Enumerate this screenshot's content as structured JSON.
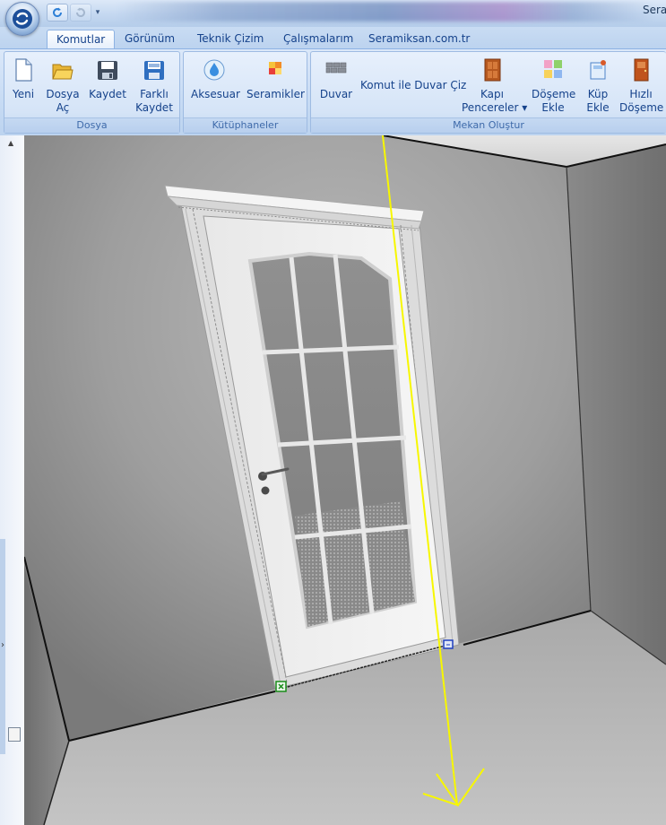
{
  "titlebar": {
    "title": "Sera",
    "qat": [
      {
        "icon": "refresh-icon"
      },
      {
        "icon": "redo-icon"
      },
      {
        "icon": "qat-dropdown-icon"
      }
    ]
  },
  "tabs": [
    {
      "label": "Komutlar",
      "active": true
    },
    {
      "label": "Görünüm"
    },
    {
      "label": "Teknik Çizim"
    },
    {
      "label": "Çalışmalarım"
    },
    {
      "label": "Seramiksan.com.tr"
    }
  ],
  "ribbon": {
    "groups": {
      "dosya": {
        "label": "Dosya",
        "buttons": {
          "yeni": {
            "l1": "Yeni",
            "l2": "",
            "icon": "new-file-icon"
          },
          "dosya_ac": {
            "l1": "Dosya",
            "l2": "Aç",
            "icon": "open-folder-icon"
          },
          "kaydet": {
            "l1": "Kaydet",
            "l2": "",
            "icon": "save-icon"
          },
          "farkli_kaydet": {
            "l1": "Farklı",
            "l2": "Kaydet",
            "icon": "save-as-icon"
          }
        }
      },
      "kutuphaneler": {
        "label": "Kütüphaneler",
        "buttons": {
          "aksesuar": {
            "l1": "Aksesuar",
            "icon": "water-drop-icon"
          },
          "seramikler": {
            "l1": "Seramikler",
            "icon": "tiles-icon"
          }
        }
      },
      "mekan": {
        "label": "Mekan Oluştur",
        "buttons": {
          "duvar": {
            "l1": "Duvar",
            "icon": "wall-icon"
          },
          "komut_duvar": {
            "l1": "Komut ile Duvar Çiz"
          },
          "kapi": {
            "l1": "Kapı",
            "l2": "Pencereler ▾",
            "icon": "door-icon"
          },
          "doseme": {
            "l1": "Döşeme",
            "l2": "Ekle",
            "icon": "floor-tiles-icon"
          },
          "kup": {
            "l1": "Küp",
            "l2": "Ekle",
            "icon": "cube-icon"
          },
          "hizli": {
            "l1": "Hızlı",
            "l2": "Döşeme",
            "icon": "door-quick-icon"
          }
        }
      }
    }
  },
  "colors": {
    "accent_yellow": "#f7f700",
    "marker_green": "#1a8c1a",
    "marker_blue": "#1f3fbf",
    "wall_gray": "#9a9a9a",
    "door_white": "#f2f2f2"
  }
}
